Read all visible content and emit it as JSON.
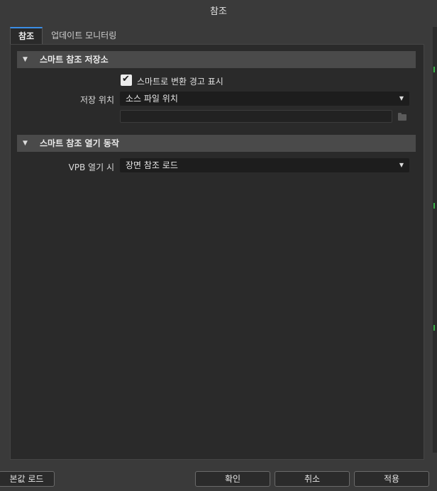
{
  "dialog": {
    "title": "참조"
  },
  "tabs": [
    {
      "label": "참조",
      "active": true
    },
    {
      "label": "업데이트 모니터링",
      "active": false
    }
  ],
  "sections": {
    "storage": {
      "title": "스마트 참조 저장소",
      "show_warning_label": "스마트로 변환 경고 표시",
      "show_warning_checked": true,
      "location_label": "저장 위치",
      "location_value": "소스 파일 위치",
      "path_value": ""
    },
    "open_behavior": {
      "title": "스마트 참조 열기 동작",
      "vpb_label": "VPB 열기 시",
      "vpb_value": "장면 참조 로드"
    }
  },
  "buttons": {
    "load_defaults": "본값 로드",
    "ok": "확인",
    "cancel": "취소",
    "apply": "적용"
  },
  "icons": {
    "section_expanded": "triangle-down-icon",
    "dropdown_caret": "caret-down-icon",
    "folder": "folder-icon",
    "check": "checkmark-icon"
  },
  "colors": {
    "window_bg": "#3a3a3a",
    "panel_bg": "#2a2a2a",
    "section_header_bg": "#4a4a4a",
    "field_bg": "#1d1d1d",
    "tab_accent": "#3a8ee6",
    "edge_indicator": "#3bb34a"
  }
}
